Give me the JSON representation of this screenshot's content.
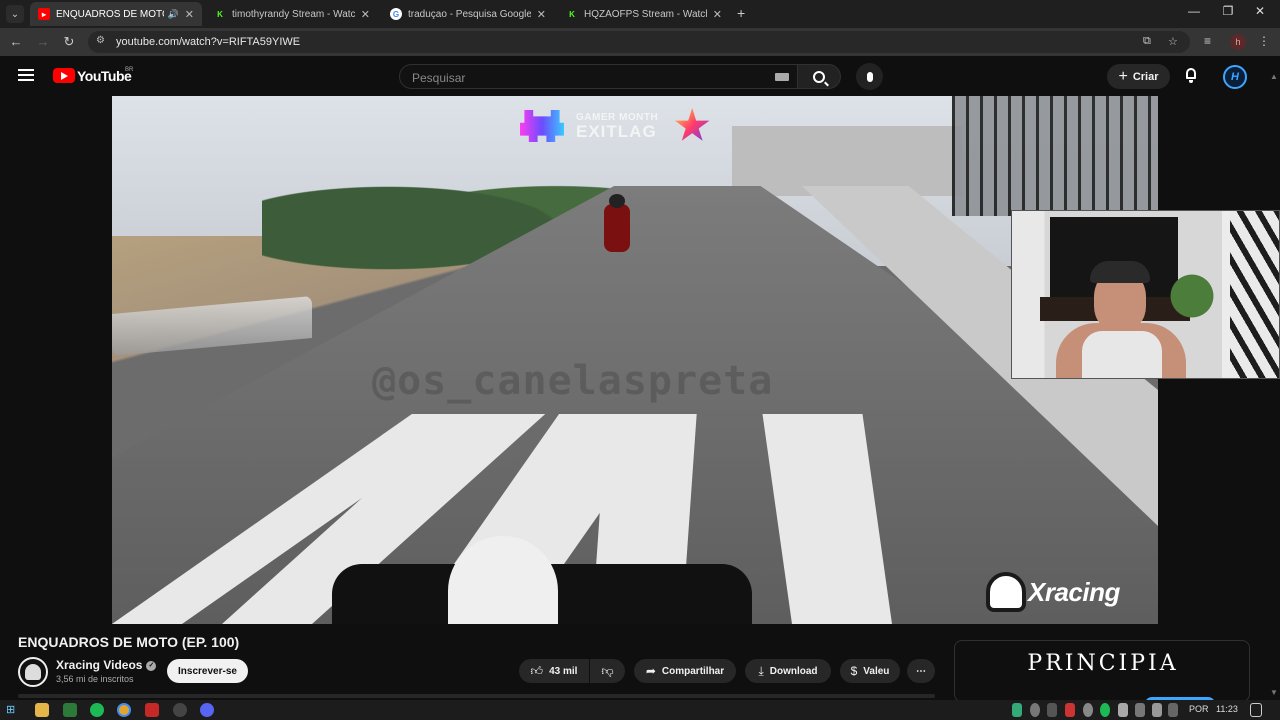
{
  "browser": {
    "tabs": [
      {
        "title": "ENQUADROS DE MOTO (EP.",
        "favicon": "youtube-icon",
        "active": true
      },
      {
        "title": "timothyrandy Stream - Watch L",
        "favicon": "kick-icon",
        "active": false
      },
      {
        "title": "traduçao - Pesquisa Google",
        "favicon": "google-icon",
        "active": false
      },
      {
        "title": "HQZAOFPS Stream - Watch Live",
        "favicon": "kick-icon",
        "active": false
      }
    ],
    "new_tab": "+",
    "url": "youtube.com/watch?v=RIFTA59YIWE",
    "profile_initial": "h"
  },
  "youtube": {
    "logo_text": "YouTube",
    "region": "BR",
    "search_placeholder": "Pesquisar",
    "create_label": "Criar",
    "avatar_letter": "H"
  },
  "video": {
    "watermark": "@os_canelaspreta",
    "sponsor_top": "GAMER MONTH",
    "sponsor_main": "EXITLAG",
    "channel_logo": "Xracing",
    "title": "ENQUADROS DE MOTO (EP. 100)"
  },
  "channel": {
    "name": "Xracing Videos",
    "subscribers": "3,56 mi de inscritos",
    "subscribe_label": "Inscrever-se"
  },
  "actions": {
    "likes": "43 mil",
    "share": "Compartilhar",
    "download": "Download",
    "thanks": "Valeu",
    "more": "⋯"
  },
  "side_card": {
    "title": "PRINCIPIA"
  },
  "taskbar": {
    "language": "POR",
    "time": "11:23"
  },
  "colors": {
    "accent_red": "#ff0000",
    "accent_blue": "#3ea6ff",
    "background": "#0f0f0f"
  }
}
